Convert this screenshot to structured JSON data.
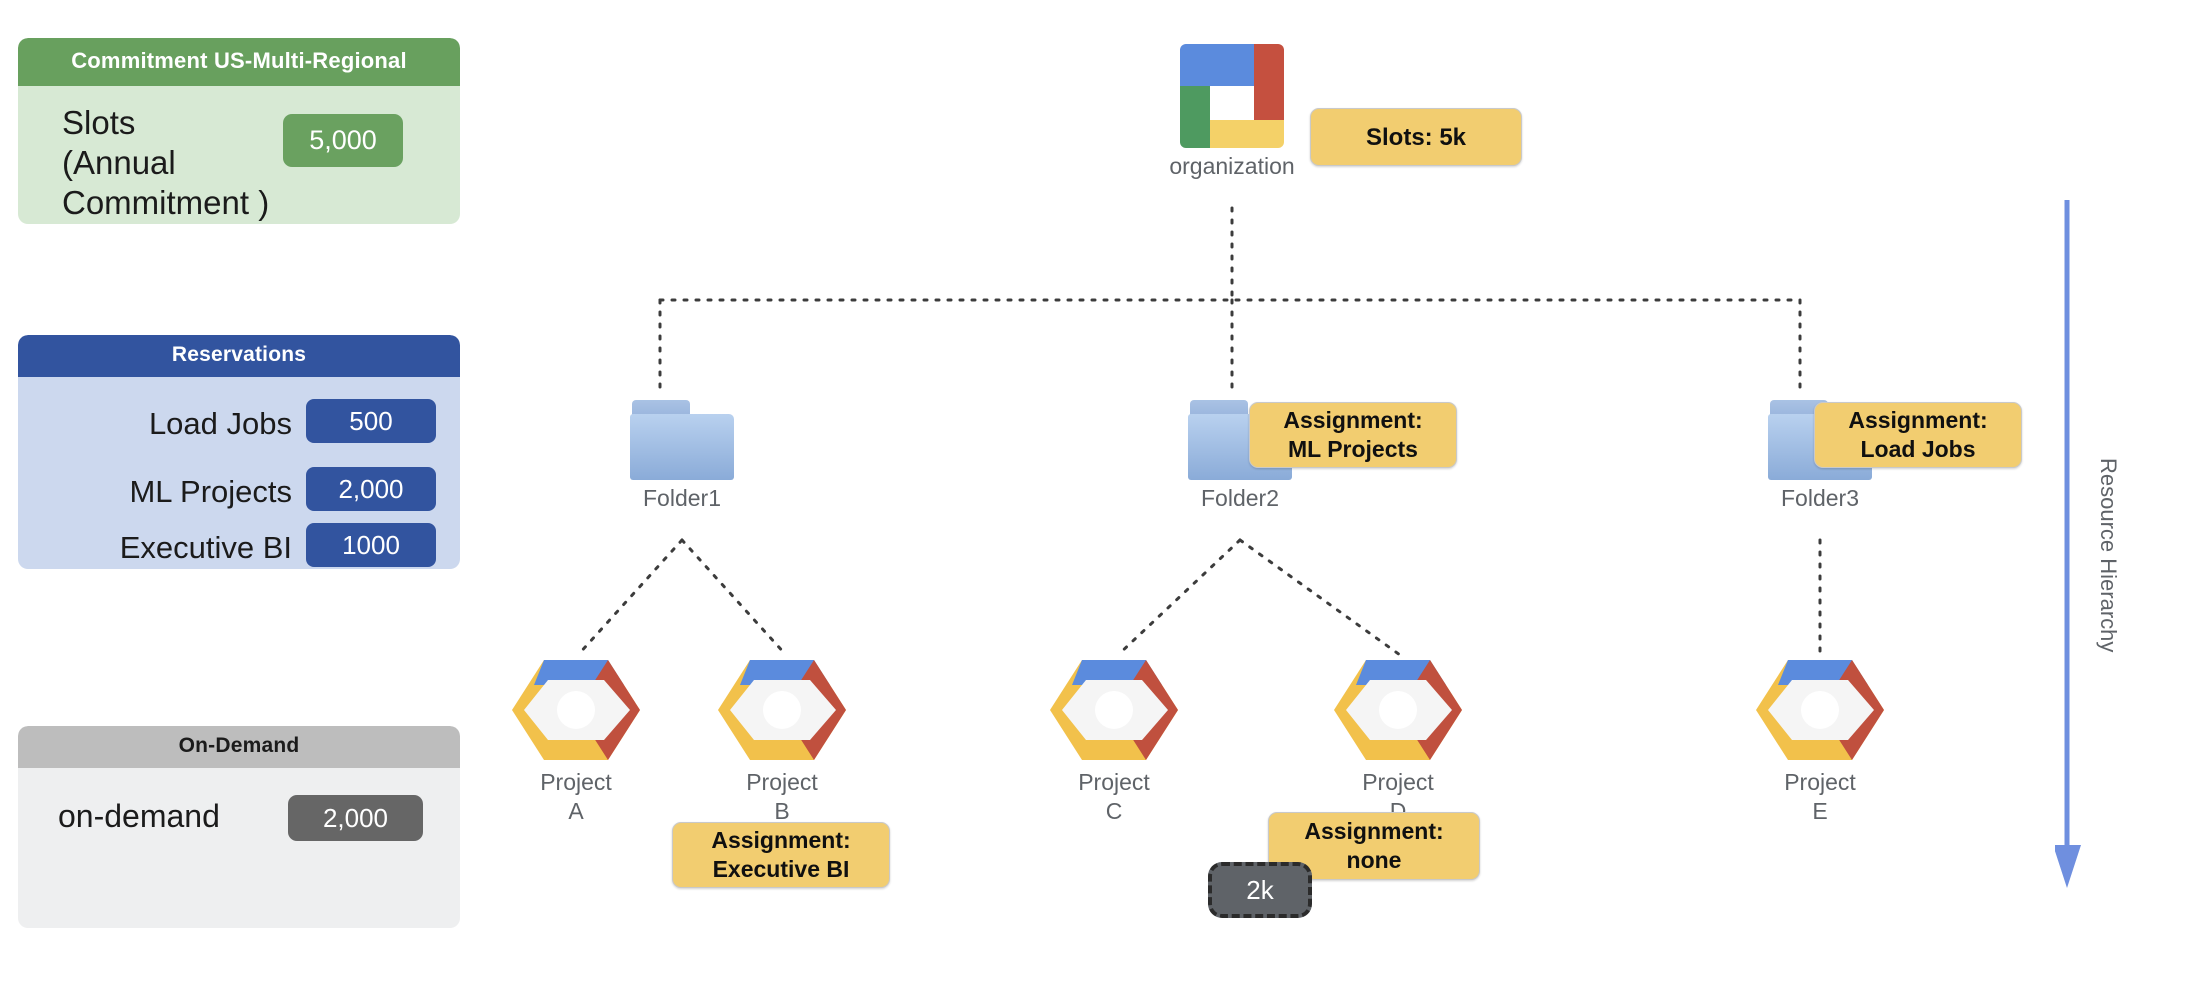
{
  "sidebar": {
    "commitment": {
      "title": "Commitment\nUS-Multi-Regional",
      "row_label": "Slots\n(Annual\nCommitment )",
      "row_value": "5,000",
      "header_color": "#68a05e",
      "body_color": "#d7e9d4",
      "chip_color": "#6aa160"
    },
    "reservations": {
      "title": "Reservations",
      "header_color": "#32549f",
      "body_color": "#ccd8ee",
      "chip_color": "#32549f",
      "rows": [
        {
          "label": "Load Jobs",
          "value": "500"
        },
        {
          "label": "ML Projects",
          "value": "2,000"
        },
        {
          "label": "Executive BI",
          "value": "1000"
        }
      ]
    },
    "on_demand": {
      "title": "On-Demand",
      "row_label": "on-demand",
      "row_value": "2,000",
      "header_color": "#bdbdbd",
      "body_color": "#eeeff0",
      "chip_color": "#666666"
    }
  },
  "diagram": {
    "organization": {
      "label": "organization",
      "icon": "google-cloud-organization-icon",
      "badge": "Slots: 5k"
    },
    "folders": [
      {
        "label": "Folder1",
        "icon": "folder-icon",
        "badge": null
      },
      {
        "label": "Folder2",
        "icon": "folder-icon",
        "badge": "Assignment:\nML Projects"
      },
      {
        "label": "Folder3",
        "icon": "folder-icon",
        "badge": "Assignment:\nLoad Jobs"
      }
    ],
    "projects": [
      {
        "label": "Project\nA",
        "icon": "google-cloud-project-icon",
        "badge": null,
        "dashed_chip": null
      },
      {
        "label": "Project\nB",
        "icon": "google-cloud-project-icon",
        "badge": "Assignment:\nExecutive BI",
        "dashed_chip": null
      },
      {
        "label": "Project\nC",
        "icon": "google-cloud-project-icon",
        "badge": null,
        "dashed_chip": null
      },
      {
        "label": "Project\nD",
        "icon": "google-cloud-project-icon",
        "badge": "Assignment:\nnone",
        "dashed_chip": "2k"
      },
      {
        "label": "Project\nE",
        "icon": "google-cloud-project-icon",
        "badge": null,
        "dashed_chip": null
      }
    ],
    "hierarchy_arrow": {
      "label": "Resource Hierarchy",
      "color": "#6f8fdf",
      "direction": "down"
    },
    "badge_color": "#f2cd70",
    "connector_style": "dotted",
    "connector_color": "#3c3c3c"
  }
}
